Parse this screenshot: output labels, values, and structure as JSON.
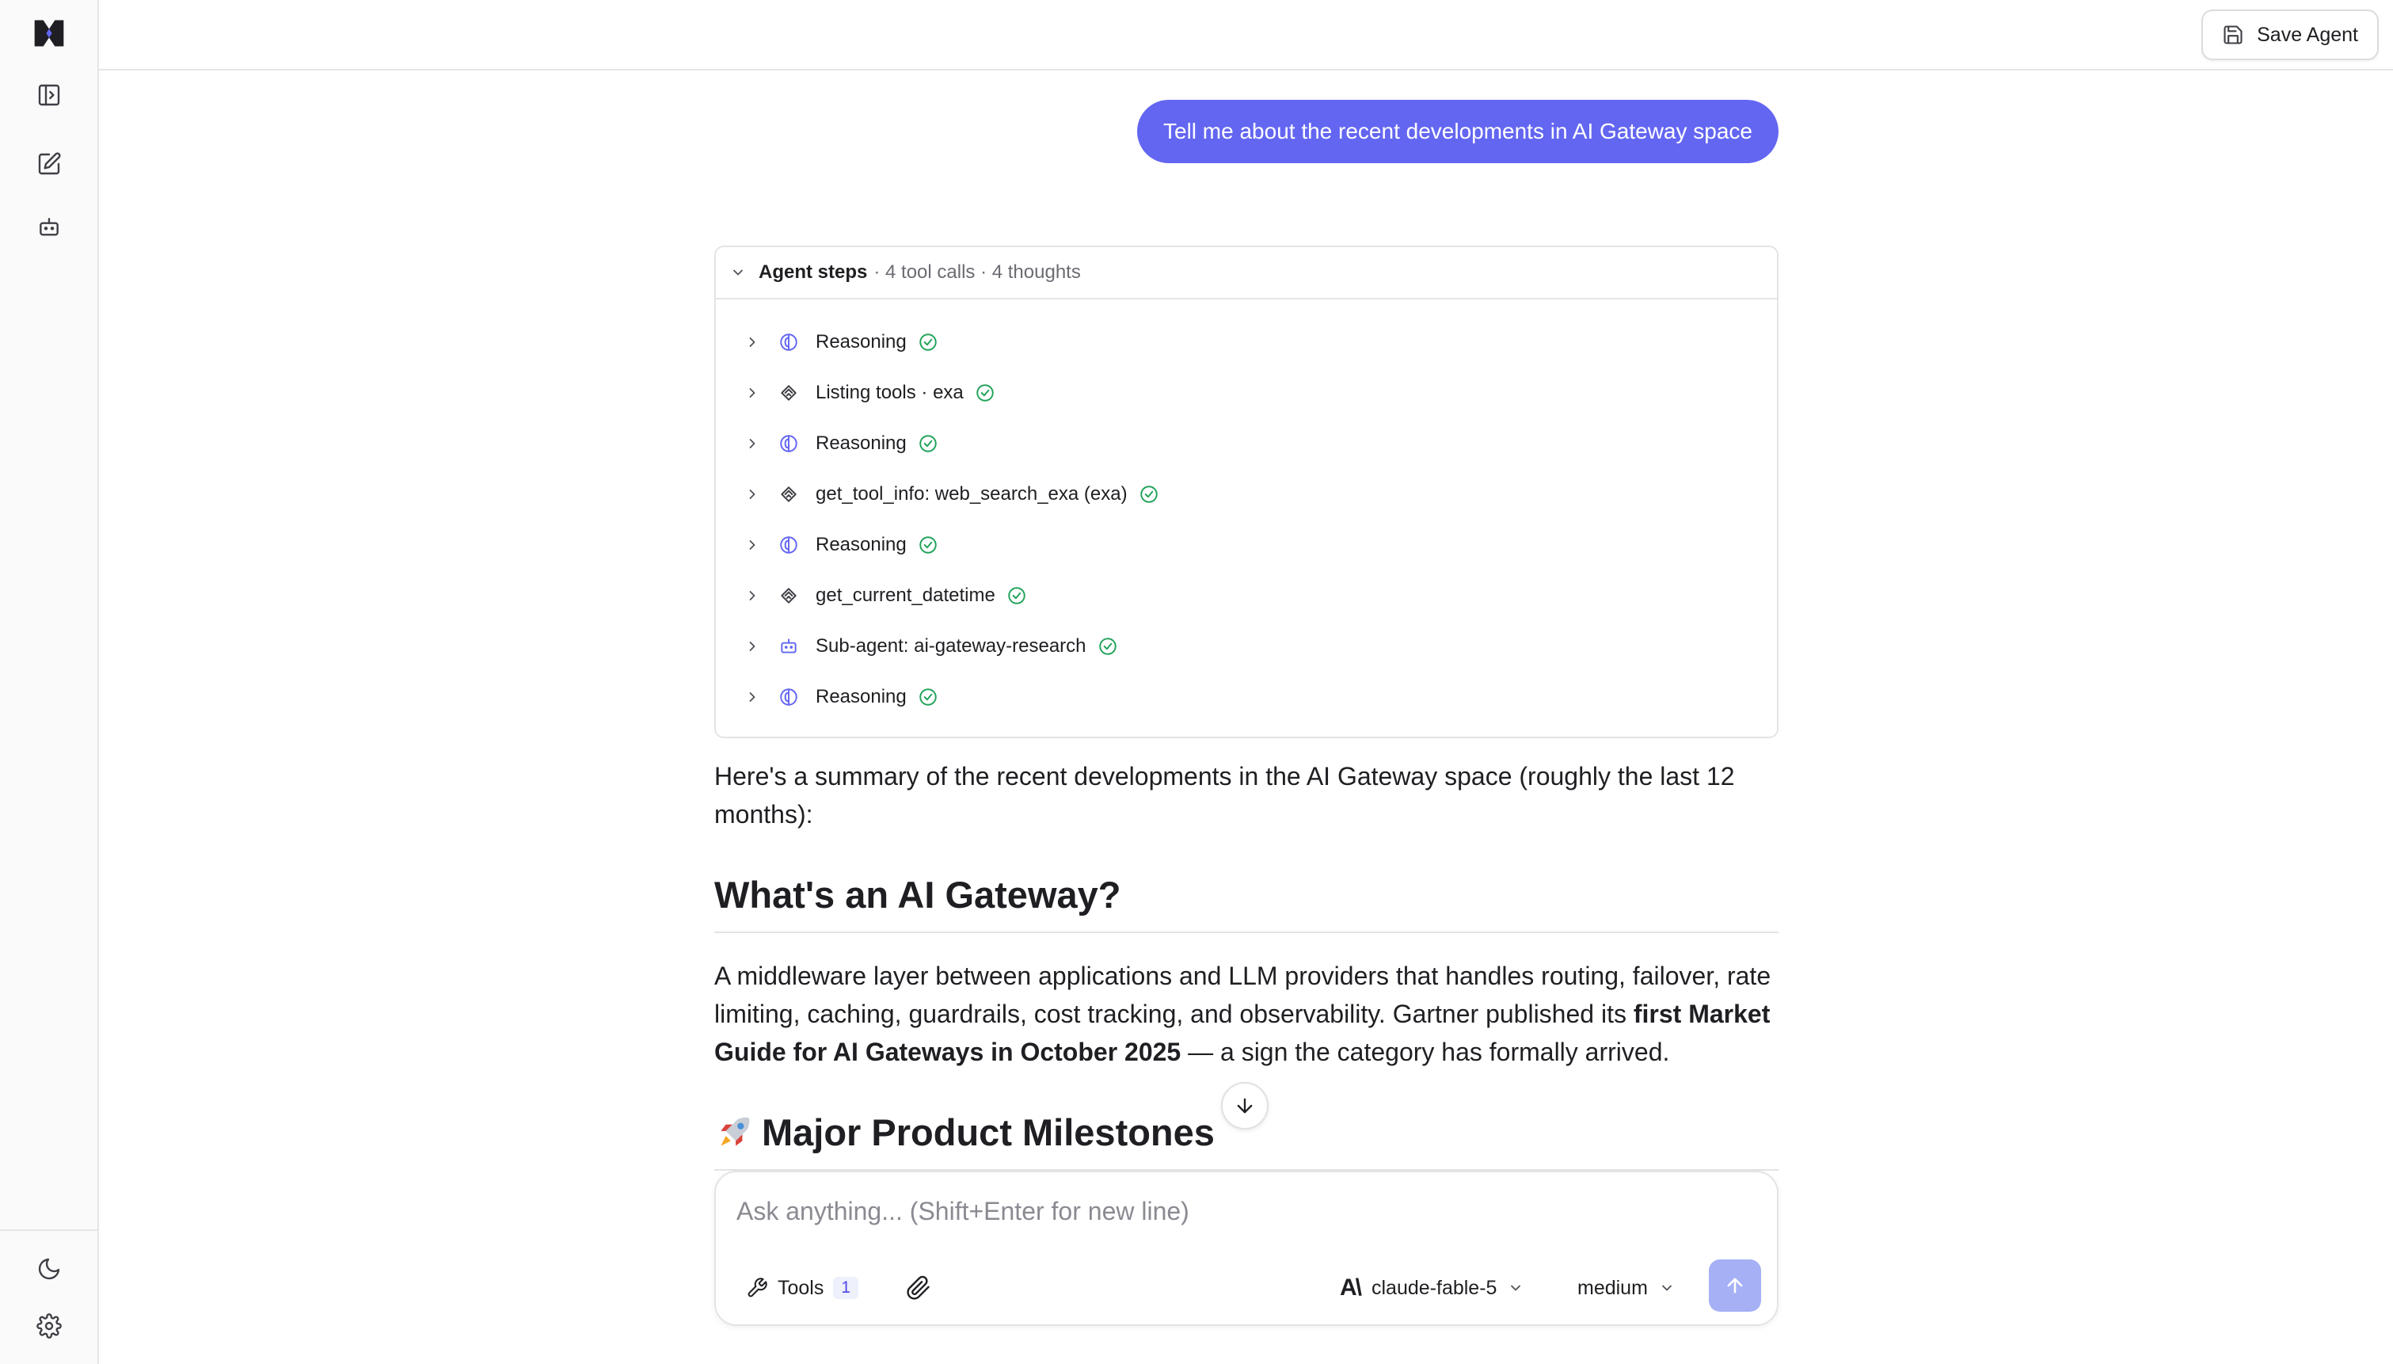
{
  "sidebar": {
    "logo_icon": "mesh-logo-icon",
    "items": [
      {
        "icon": "sidebar-toggle-icon"
      },
      {
        "icon": "new-chat-icon"
      },
      {
        "icon": "agents-bot-icon"
      }
    ],
    "bottom": [
      {
        "icon": "theme-moon-icon"
      },
      {
        "icon": "settings-gear-icon"
      }
    ]
  },
  "header": {
    "save_label": "Save Agent"
  },
  "conversation": {
    "user_message": "Tell me about the recent developments in AI Gateway space",
    "agent_steps": {
      "title": "Agent steps",
      "meta": "· 4 tool calls · 4 thoughts",
      "steps": [
        {
          "type": "reasoning",
          "label": "Reasoning"
        },
        {
          "type": "tool",
          "label": "Listing tools · exa"
        },
        {
          "type": "reasoning",
          "label": "Reasoning"
        },
        {
          "type": "tool",
          "label": "get_tool_info: web_search_exa (exa)"
        },
        {
          "type": "reasoning",
          "label": "Reasoning"
        },
        {
          "type": "tool",
          "label": "get_current_datetime"
        },
        {
          "type": "subagent",
          "label": "Sub-agent: ai-gateway-research"
        },
        {
          "type": "reasoning",
          "label": "Reasoning"
        }
      ]
    },
    "response": {
      "intro": "Here's a summary of the recent developments in the AI Gateway space (roughly the last 12 months):",
      "h1": "What's an AI Gateway?",
      "p2_a": "A middleware layer between applications and LLM providers that handles routing, failover, rate limiting, caching, guardrails, cost tracking, and observability. Gartner published its ",
      "p2_bold": "first Market Guide for AI Gateways in October 2025",
      "p2_b": " — a sign the category has formally arrived.",
      "h2": "Major Product Milestones",
      "h2_icon": "rocket-emoji-icon"
    }
  },
  "composer": {
    "placeholder": "Ask anything... (Shift+Enter for new line)",
    "tools_label": "Tools",
    "tools_count": "1",
    "model": "claude-fable-5",
    "model_logo": "A\\",
    "effort": "medium"
  },
  "colors": {
    "accent": "#6366f1",
    "success": "#22a35a",
    "send_disabled": "#a5b0f5"
  }
}
